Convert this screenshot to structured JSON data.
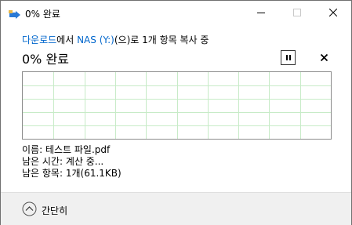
{
  "window": {
    "title": "0% 완료"
  },
  "header": {
    "from_prefix": "다운로드",
    "from_suffix": "에서 ",
    "to_location": "NAS (Y:)",
    "to_suffix": "(으)로 1개 항목 복사 중",
    "status": "0% 완료"
  },
  "details": {
    "name_line": "이름: 테스트 파일.pdf",
    "time_line": "남은 시간: 계산 중...",
    "items_line": "남은 항목: 1개(61.1KB)"
  },
  "footer": {
    "collapse_label": "간단히"
  },
  "progress": {
    "percent": 0
  },
  "colors": {
    "link": "#0066cc",
    "grid": "#c7ebc7"
  }
}
